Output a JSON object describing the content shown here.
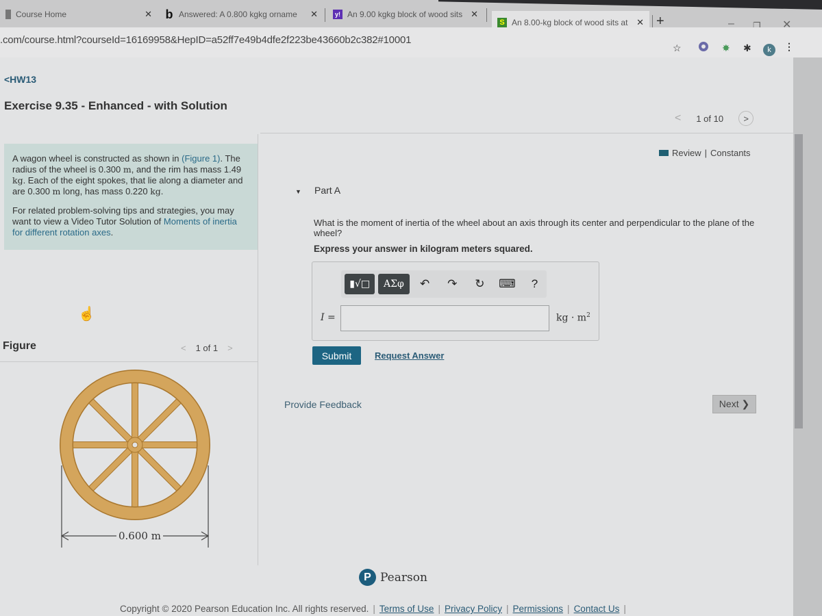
{
  "browser": {
    "tabs": [
      {
        "title": "Course Home",
        "favicon": "page-icon",
        "active": false
      },
      {
        "title": "Answered: A 0.800 kgkg orname",
        "favicon": "b",
        "active": false
      },
      {
        "title": "An 9.00 kgkg block of wood sits",
        "favicon": "y!",
        "active": false
      },
      {
        "title": "An 8.00-kg block of wood sits at",
        "favicon": "S",
        "active": true
      }
    ],
    "new_tab": "+",
    "url": ".com/course.html?courseId=16169958&HepID=a52ff7e49b4dfe2f223be43660b2c382#10001",
    "profile_initial": "k",
    "window_controls": {
      "minimize": "–",
      "restore": "❐",
      "close": "✕"
    },
    "icons": [
      "star-icon",
      "extension-circle-icon",
      "extension-green-icon",
      "puzzle-icon",
      "profile-icon",
      "menu-icon"
    ]
  },
  "page": {
    "back_link": "<HW13",
    "title": "Exercise 9.35 - Enhanced - with Solution",
    "pager": {
      "prev": "<",
      "label": "1 of 10",
      "next": ">"
    },
    "review": "Review",
    "constants": "Constants",
    "review_sep": "|"
  },
  "problem": {
    "p1_a": "A wagon wheel is constructed as shown in ",
    "p1_link": "(Figure 1)",
    "p1_b": ". The radius of the wheel is 0.300 ",
    "unit_m": "m",
    "p1_c": ", and the rim has mass 1.49 ",
    "unit_kg": "kg",
    "p1_d": ". Each of the eight spokes, that lie along a diameter and are 0.300 ",
    "p1_e": " long, has mass 0.220 ",
    "p1_f": ".",
    "p2_a": "For related problem-solving tips and strategies, you may want to view a Video Tutor Solution of ",
    "p2_link": "Moments of inertia for different rotation axes",
    "p2_b": "."
  },
  "figure": {
    "label": "Figure",
    "pager": {
      "prev": "<",
      "label": "1 of 1",
      "next": ">"
    },
    "dimension_label": "0.600 m",
    "colors": {
      "wood": "#d4a55c",
      "outline": "#a9772e"
    }
  },
  "part_a": {
    "title": "Part A",
    "question": "What is the moment of inertia of the wheel about an axis through its center and perpendicular to the plane of the wheel?",
    "instruction": "Express your answer in kilogram meters squared.",
    "toolbar": {
      "templates": "▮√□",
      "greek": "ΑΣφ",
      "undo": "↶",
      "redo": "↷",
      "reset": "↻",
      "keyboard": "⌨",
      "help": "?"
    },
    "variable": "I =",
    "answer_value": "",
    "units": "kg · m",
    "units_exp": "2",
    "submit": "Submit",
    "request_answer": "Request Answer"
  },
  "feedback": "Provide Feedback",
  "next": "Next ❯",
  "pearson": {
    "logo": "P",
    "name": "Pearson"
  },
  "footer": {
    "copyright": "Copyright © 2020 Pearson Education Inc. All rights reserved.",
    "links": [
      "Terms of Use",
      "Privacy Policy",
      "Permissions",
      "Contact Us"
    ],
    "sep": "|"
  },
  "colors": {
    "accent": "#1d6583",
    "link": "#2a5b76",
    "problem_bg": "#c9d9d6"
  }
}
